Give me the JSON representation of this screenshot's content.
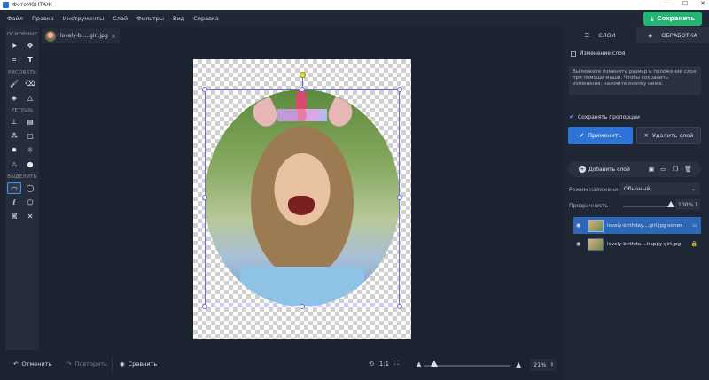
{
  "window": {
    "title": "ФотоМОНТАЖ",
    "controls": [
      "—",
      "☐",
      "✕"
    ]
  },
  "menu": {
    "items": [
      "Файл",
      "Правка",
      "Инструменты",
      "Слой",
      "Фильтры",
      "Вид",
      "Справка"
    ],
    "save_label": "Сохранить"
  },
  "toolbox": {
    "sections": {
      "basic": "ОСНОВНЫЕ",
      "draw": "РИСОВАТЬ",
      "retouch": "РЕТУШЬ",
      "select": "ВЫДЕЛИТЬ"
    }
  },
  "tab": {
    "label": "lovely-bi....girl.jpg"
  },
  "bottom": {
    "undo_label": "Отменить",
    "redo_label": "Повторить",
    "compare_label": "Сравнить",
    "one_to_one": "1:1",
    "zoom_value": "21%",
    "zoom_level": 0.12
  },
  "rpanel": {
    "tab_layers": "СЛОИ",
    "tab_processing": "ОБРАБОТКА",
    "resize_layer_label": "Изменение слоя",
    "info_text": "Вы можете изменить размер и положение слоя при помощи мыши. Чтобы сохранить изменения, нажмите кнопку ниже.",
    "keep_proportions_label": "Сохранять пропорции",
    "apply_label": "Применить",
    "delete_layer_label": "Удалить слой",
    "add_layer_label": "Добавить слой",
    "blend_mode_label": "Режим наложения:",
    "blend_mode_value": "Обычный",
    "opacity_label": "Прозрачность",
    "opacity_value": "100%",
    "opacity_level": 1.0,
    "layers": [
      {
        "name": "lovely-birthday....girl.jpg копия"
      },
      {
        "name": "lovely-birthda....happy-girl.jpg"
      }
    ]
  },
  "colors": {
    "accent": "#2e74d6",
    "save": "#22b573",
    "selection": "#6d6cdc"
  }
}
